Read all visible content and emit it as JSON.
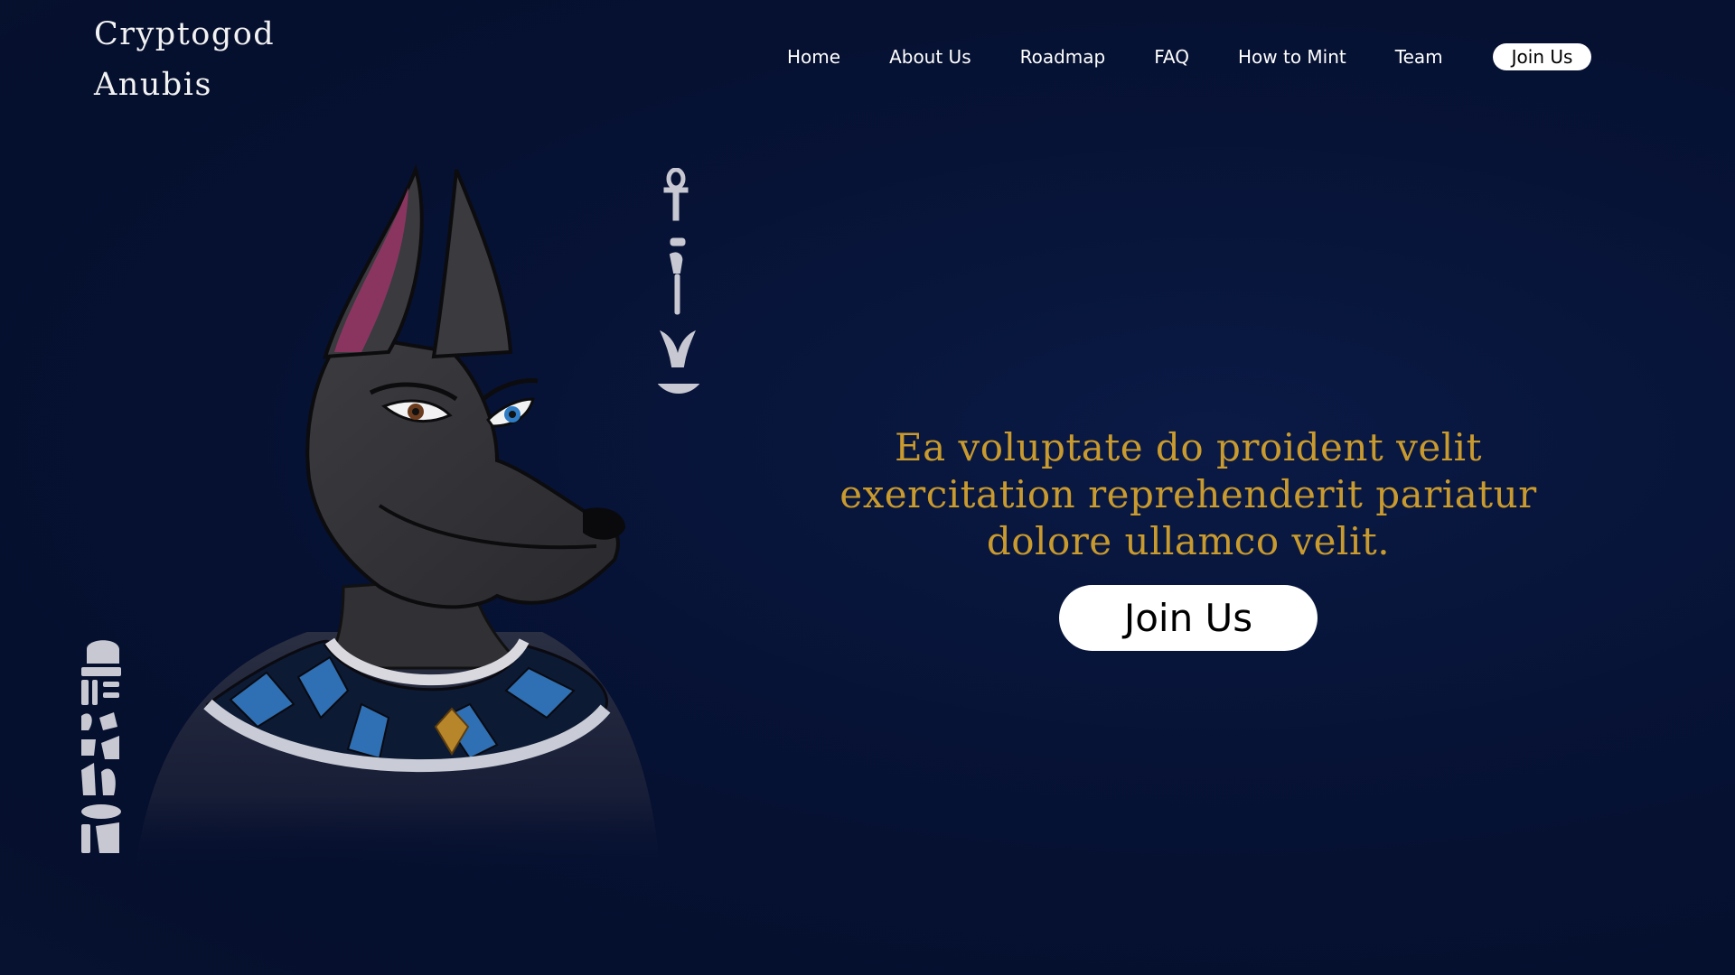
{
  "brand": {
    "line1": "Cryptogod",
    "line2": "Anubis"
  },
  "nav": {
    "items": [
      {
        "label": "Home"
      },
      {
        "label": "About Us"
      },
      {
        "label": "Roadmap"
      },
      {
        "label": "FAQ"
      },
      {
        "label": "How to Mint"
      },
      {
        "label": "Team"
      }
    ],
    "cta_label": "Join Us"
  },
  "hero": {
    "heading": "Ea voluptate do proident velit exercitation reprehenderit pariatur dolore ullamco velit.",
    "button_label": "Join Us",
    "image": "anubis-character-illustration"
  },
  "colors": {
    "background": "#06122f",
    "heading_gold": "#c99a2e",
    "button_bg": "#ffffff",
    "button_text": "#000000"
  }
}
